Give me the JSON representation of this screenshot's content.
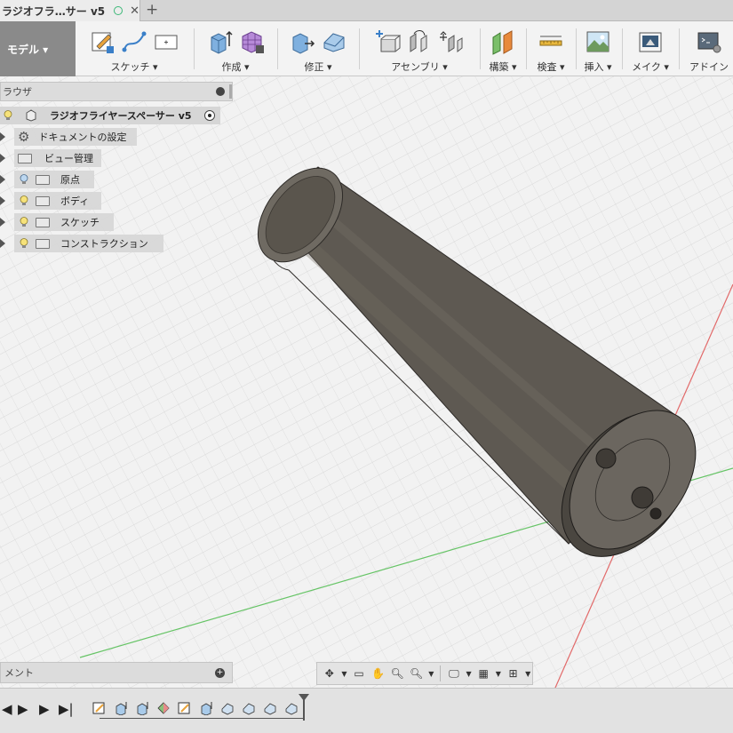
{
  "tab": {
    "title": "ラジオフラ…サー v5"
  },
  "toolbar": {
    "workspace": "モデル ▾",
    "groups": {
      "sketch": "スケッチ ▾",
      "create": "作成 ▾",
      "modify": "修正 ▾",
      "assemble": "アセンブリ ▾",
      "construct": "構築 ▾",
      "inspect": "検査 ▾",
      "insert": "挿入 ▾",
      "make": "メイク ▾",
      "addins": "アドイン"
    }
  },
  "browser": {
    "title": "ラウザ",
    "root": "ラジオフライヤースペーサー v5",
    "items": [
      {
        "label": "ドキュメントの設定"
      },
      {
        "label": "ビュー管理"
      },
      {
        "label": "原点"
      },
      {
        "label": "ボディ"
      },
      {
        "label": "スケッチ"
      },
      {
        "label": "コンストラクション"
      }
    ]
  },
  "comments": {
    "title": "メント"
  },
  "colors": {
    "accent_green": "#3cb878",
    "axis_red": "#e25c5c",
    "axis_green": "#5fc45f",
    "body": "#6b665f"
  }
}
